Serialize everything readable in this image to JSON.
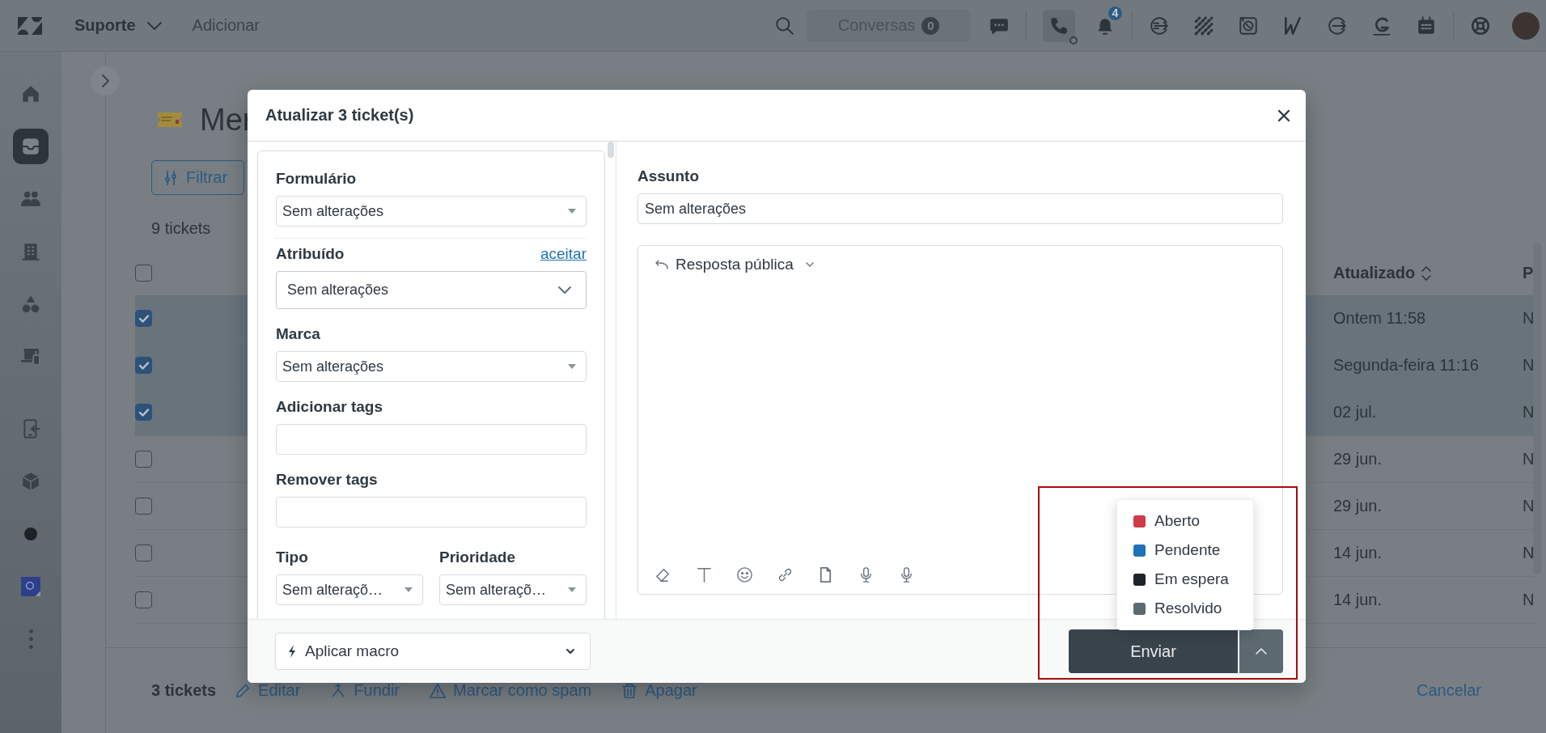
{
  "topbar": {
    "workspace": "Suporte",
    "add_label": "Adicionar",
    "conversations": {
      "label": "Conversas",
      "count": "0"
    },
    "notifications_badge": "4"
  },
  "sidebar": {
    "groups": [
      {
        "items": [
          {
            "kind": "home",
            "selected": false
          },
          {
            "kind": "inbox",
            "selected": true
          },
          {
            "kind": "people",
            "selected": false
          },
          {
            "kind": "building",
            "selected": false
          },
          {
            "kind": "shapes",
            "selected": false
          },
          {
            "kind": "devices",
            "selected": false
          }
        ]
      },
      {
        "items": [
          {
            "kind": "phone-transfer",
            "selected": false
          },
          {
            "kind": "cube",
            "selected": false
          },
          {
            "kind": "dot",
            "selected": false
          },
          {
            "kind": "app",
            "selected": false
          },
          {
            "kind": "more",
            "selected": false
          }
        ]
      }
    ]
  },
  "page": {
    "title": "Mer",
    "filter_label": "Filtrar",
    "ticket_count": "9 tickets",
    "table": {
      "select_all": {
        "checked": false
      },
      "columns": [
        {
          "label": "Atualizado",
          "sortable": true
        },
        {
          "label": "P",
          "sortable": false
        }
      ],
      "rows": [
        {
          "selected": true,
          "cells": [
            "Ontem 11:58",
            "N"
          ]
        },
        {
          "selected": true,
          "cells": [
            "Segunda-feira 11:16",
            "N"
          ]
        },
        {
          "selected": true,
          "cells": [
            "02 jul.",
            "N"
          ]
        },
        {
          "selected": false,
          "cells": [
            "29 jun.",
            "N"
          ]
        },
        {
          "selected": false,
          "cells": [
            "29 jun.",
            "N"
          ]
        },
        {
          "selected": false,
          "cells": [
            "14 jun.",
            "N"
          ]
        },
        {
          "selected": false,
          "cells": [
            "14 jun.",
            "N"
          ]
        }
      ]
    }
  },
  "bulk_bar": {
    "count": "3 tickets",
    "actions": [
      {
        "kind": "edit",
        "label": "Editar"
      },
      {
        "kind": "merge",
        "label": "Fundir"
      },
      {
        "kind": "spam",
        "label": "Marcar como spam"
      },
      {
        "kind": "delete",
        "label": "Apagar"
      }
    ],
    "cancel": "Cancelar"
  },
  "modal": {
    "title": "Atualizar 3 ticket(s)",
    "fields": [
      {
        "kind": "select",
        "label": "Formulário",
        "value": "Sem alterações"
      },
      {
        "kind": "separator"
      },
      {
        "kind": "combobox",
        "label": "Atribuído",
        "link": "aceitar",
        "value": "Sem alterações"
      },
      {
        "kind": "select",
        "label": "Marca",
        "value": "Sem alterações"
      },
      {
        "kind": "text",
        "label": "Adicionar tags"
      },
      {
        "kind": "text",
        "label": "Remover tags"
      },
      {
        "kind": "pair",
        "fields": [
          {
            "kind": "select",
            "label": "Tipo",
            "value": "Sem alteraçõ…"
          },
          {
            "kind": "select",
            "label": "Prioridade",
            "value": "Sem alteraçõ…"
          }
        ]
      }
    ],
    "macro": {
      "label": "Aplicar macro"
    },
    "subject": {
      "label": "Assunto",
      "value": "Sem alterações"
    },
    "editor": {
      "channel": "Resposta pública"
    },
    "status_menu": [
      {
        "label": "Aberto",
        "color": "#d13a47"
      },
      {
        "label": "Pendente",
        "color": "#1f73b7"
      },
      {
        "label": "Em espera",
        "color": "#1f2329"
      },
      {
        "label": "Resolvido",
        "color": "#5c6970"
      }
    ],
    "submit": {
      "label": "Enviar"
    }
  }
}
